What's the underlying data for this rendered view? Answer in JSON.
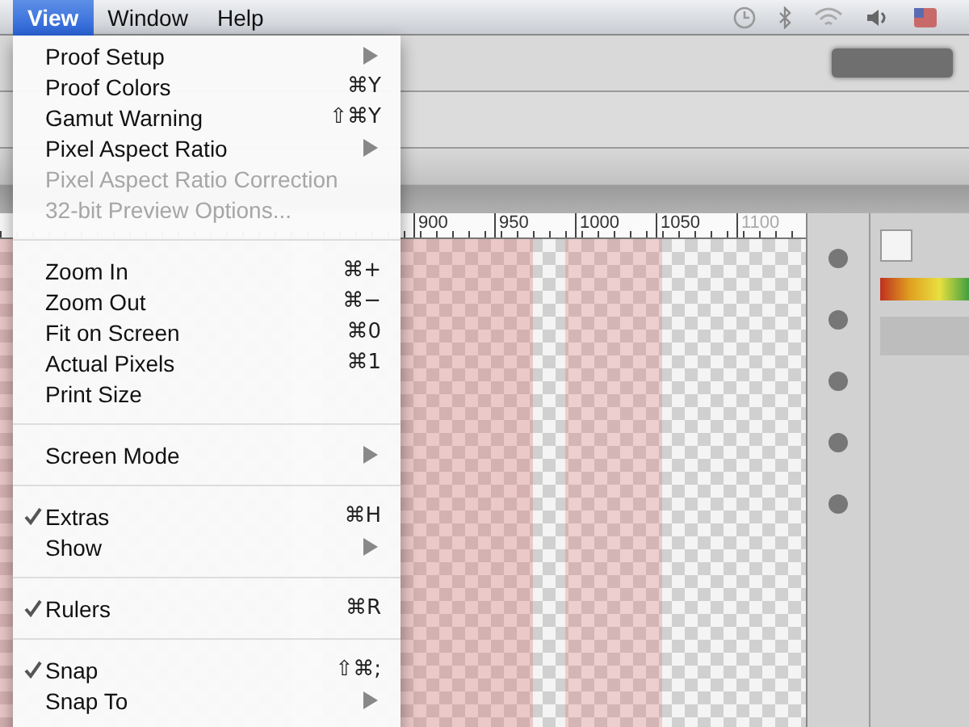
{
  "menubar": {
    "menus": [
      {
        "label": "View",
        "selected": true
      },
      {
        "label": "Window",
        "selected": false
      },
      {
        "label": "Help",
        "selected": false
      }
    ]
  },
  "ruler": {
    "labels": [
      "900",
      "950",
      "1000",
      "1050",
      "1100"
    ]
  },
  "view_menu": {
    "sections": [
      {
        "items": [
          {
            "label": "Proof Setup",
            "submenu": true,
            "disabled": false,
            "checked": false
          },
          {
            "label": "Proof Colors",
            "shortcut": "⌘Y",
            "submenu": false,
            "disabled": false,
            "checked": false
          },
          {
            "label": "Gamut Warning",
            "shortcut": "⇧⌘Y",
            "submenu": false,
            "disabled": false,
            "checked": false
          },
          {
            "label": "Pixel Aspect Ratio",
            "submenu": true,
            "disabled": false,
            "checked": false
          },
          {
            "label": "Pixel Aspect Ratio Correction",
            "submenu": false,
            "disabled": true,
            "checked": false
          },
          {
            "label": "32-bit Preview Options...",
            "submenu": false,
            "disabled": true,
            "checked": false
          }
        ]
      },
      {
        "items": [
          {
            "label": "Zoom In",
            "shortcut": "⌘+",
            "submenu": false,
            "disabled": false,
            "checked": false
          },
          {
            "label": "Zoom Out",
            "shortcut": "⌘−",
            "submenu": false,
            "disabled": false,
            "checked": false
          },
          {
            "label": "Fit on Screen",
            "shortcut": "⌘0",
            "submenu": false,
            "disabled": false,
            "checked": false
          },
          {
            "label": "Actual Pixels",
            "shortcut": "⌘1",
            "submenu": false,
            "disabled": false,
            "checked": false
          },
          {
            "label": "Print Size",
            "submenu": false,
            "disabled": false,
            "checked": false
          }
        ]
      },
      {
        "items": [
          {
            "label": "Screen Mode",
            "submenu": true,
            "disabled": false,
            "checked": false
          }
        ]
      },
      {
        "items": [
          {
            "label": "Extras",
            "shortcut": "⌘H",
            "submenu": false,
            "disabled": false,
            "checked": true
          },
          {
            "label": "Show",
            "submenu": true,
            "disabled": false,
            "checked": false
          }
        ]
      },
      {
        "items": [
          {
            "label": "Rulers",
            "shortcut": "⌘R",
            "submenu": false,
            "disabled": false,
            "checked": true
          }
        ]
      },
      {
        "items": [
          {
            "label": "Snap",
            "shortcut": "⇧⌘;",
            "submenu": false,
            "disabled": false,
            "checked": true
          },
          {
            "label": "Snap To",
            "submenu": true,
            "disabled": false,
            "checked": false
          }
        ]
      }
    ]
  }
}
